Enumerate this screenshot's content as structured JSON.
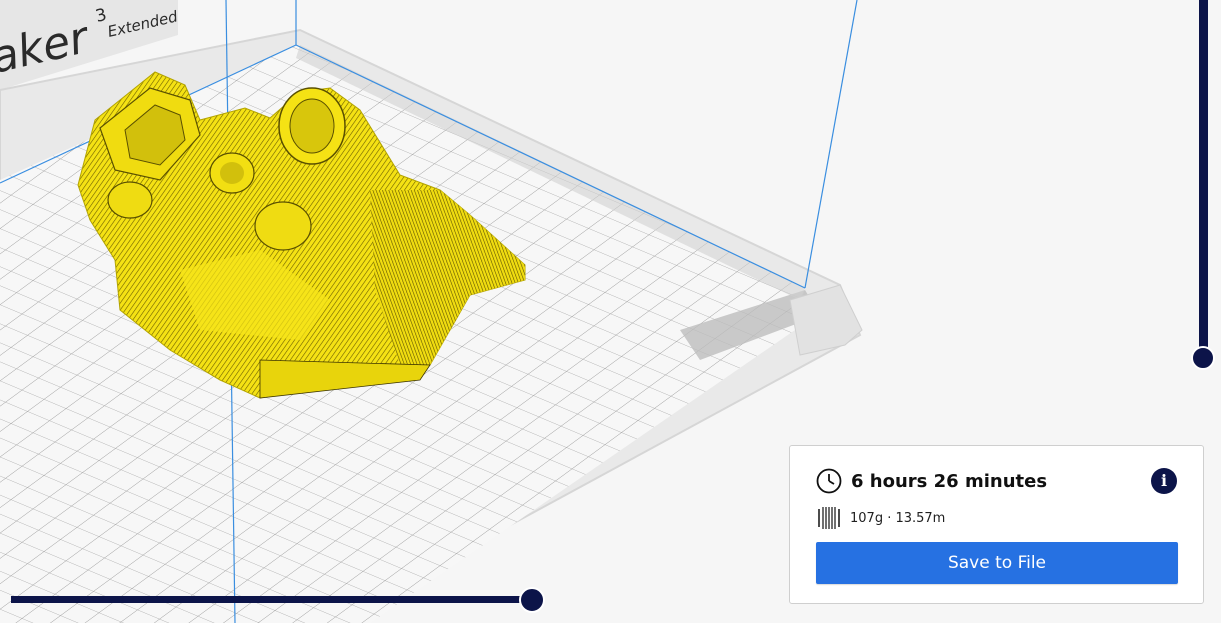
{
  "viewport": {
    "machine_label": "aker",
    "machine_version": "3",
    "machine_edition": "Extended",
    "model_color": "#f5e214"
  },
  "sliders": {
    "layer_slider_color": "#0c1449",
    "path_slider_color": "#0c1449"
  },
  "print_info": {
    "time": "6 hours 26 minutes",
    "material": "107g · 13.57m",
    "save_label": "Save to File",
    "clock_icon": "clock-icon",
    "info_icon": "info-icon",
    "info_glyph": "i",
    "spool_icon": "filament-spool-icon",
    "accent_color": "#2671e2"
  }
}
